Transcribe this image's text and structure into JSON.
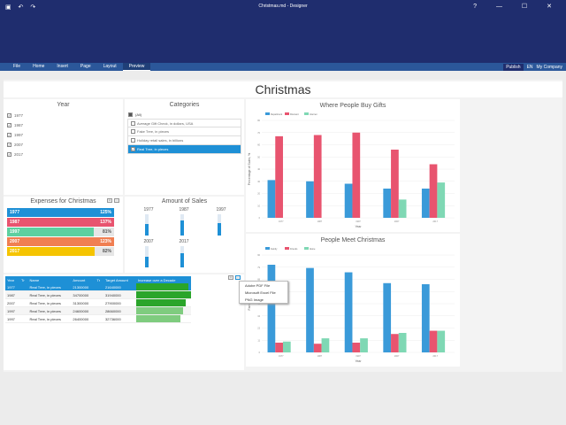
{
  "window": {
    "title": "Christmas.md - Designer",
    "quick_icons": "▣ ↶ ↷",
    "controls": "? — ☐ ✕"
  },
  "menu": {
    "items": [
      "File",
      "Home",
      "Insert",
      "Page",
      "Layout",
      "Preview"
    ],
    "active": "Preview",
    "publish": "Publish",
    "lang": "EN",
    "company": "My Company"
  },
  "dashboard": {
    "title": "Christmas"
  },
  "year_panel": {
    "title": "Year",
    "items": [
      {
        "label": "1977",
        "checked": true
      },
      {
        "label": "1987",
        "checked": true
      },
      {
        "label": "1997",
        "checked": true
      },
      {
        "label": "2007",
        "checked": true
      },
      {
        "label": "2017",
        "checked": true
      }
    ]
  },
  "categories_panel": {
    "title": "Categories",
    "all_label": "(All)",
    "items": [
      {
        "label": "Average Gift Check, in dollars, USA",
        "selected": false
      },
      {
        "label": "Fake Tree, in pieces",
        "selected": false
      },
      {
        "label": "Holiday retail sales, in billions",
        "selected": false
      },
      {
        "label": "Real Tree, in pieces",
        "selected": true
      }
    ]
  },
  "expenses_panel": {
    "title": "Expenses for Christmas",
    "bars": [
      {
        "year": "1977",
        "value": "125%",
        "fill": 1.0,
        "color": "#1e90d6"
      },
      {
        "year": "1987",
        "value": "137%",
        "fill": 1.0,
        "color": "#e8546f"
      },
      {
        "year": "1997",
        "value": "81%",
        "fill": 0.81,
        "color": "#5dd0a0"
      },
      {
        "year": "2007",
        "value": "123%",
        "fill": 1.0,
        "color": "#f07f52"
      },
      {
        "year": "2017",
        "value": "82%",
        "fill": 0.82,
        "color": "#f5c400"
      }
    ]
  },
  "sales_panel": {
    "title": "Amount of Sales",
    "gauges": [
      {
        "year": "1977",
        "level": 0.55
      },
      {
        "year": "1987",
        "level": 0.7
      },
      {
        "year": "1997",
        "level": 0.6
      },
      {
        "year": "2007",
        "level": 0.5
      },
      {
        "year": "2017",
        "level": 0.65
      }
    ]
  },
  "table": {
    "headers": [
      "Year",
      "Tr",
      "Name",
      "Amount",
      "Tr",
      "Target Amount",
      "Increase over a Decade"
    ],
    "rows": [
      {
        "year": "1977",
        "name": "Real Tree, in pieces",
        "amount": "21300000",
        "target": "21640000",
        "increase": "",
        "fill": 0.95
      },
      {
        "year": "1987",
        "name": "Real Tree, in pieces",
        "amount": "34700000",
        "target": "31940000",
        "increase": "",
        "fill": 1.0
      },
      {
        "year": "2007",
        "name": "Real Tree, in pieces",
        "amount": "31300000",
        "target": "27900000",
        "increase": "",
        "fill": 0.9
      },
      {
        "year": "1997",
        "name": "Real Tree, in pieces",
        "amount": "24600000",
        "target": "28660000",
        "increase": "",
        "fill": 0.85
      },
      {
        "year": "1997",
        "name": "Real Tree, in pieces",
        "amount": "26400000",
        "target": "32736000",
        "increase": "",
        "fill": 0.8
      }
    ]
  },
  "context_menu": {
    "items": [
      "Adobe PDF File",
      "Microsoft Excel File",
      "PNG Image"
    ]
  },
  "chart_data": [
    {
      "type": "bar",
      "title": "Where People Buy Gifts",
      "xlabel": "Year",
      "ylabel": "Percentage of Sales, %",
      "categories": [
        "1977",
        "1987",
        "1997",
        "2007",
        "2017"
      ],
      "series": [
        {
          "name": "Department",
          "color": "#3a9ad9",
          "values": [
            31,
            30,
            28,
            24,
            24
          ]
        },
        {
          "name": "Discount",
          "color": "#e8546f",
          "values": [
            67,
            68,
            70,
            56,
            44
          ]
        },
        {
          "name": "Internet",
          "color": "#7fd8b4",
          "values": [
            0,
            0,
            0,
            15,
            29
          ]
        }
      ],
      "ylim": [
        0,
        80
      ]
    },
    {
      "type": "bar",
      "title": "People Meet Christmas",
      "xlabel": "Year",
      "ylabel": "Family, %",
      "categories": [
        "1977",
        "1987",
        "1997",
        "2007",
        "2017"
      ],
      "series": [
        {
          "name": "Family",
          "color": "#3a9ad9",
          "values": [
            81,
            78,
            74,
            64,
            63
          ]
        },
        {
          "name": "Friends",
          "color": "#e8546f",
          "values": [
            9,
            8,
            9,
            17,
            20
          ]
        },
        {
          "name": "Alone",
          "color": "#7fd8b4",
          "values": [
            10,
            13,
            13,
            18,
            20
          ]
        }
      ],
      "ylim": [
        0,
        90
      ]
    }
  ]
}
